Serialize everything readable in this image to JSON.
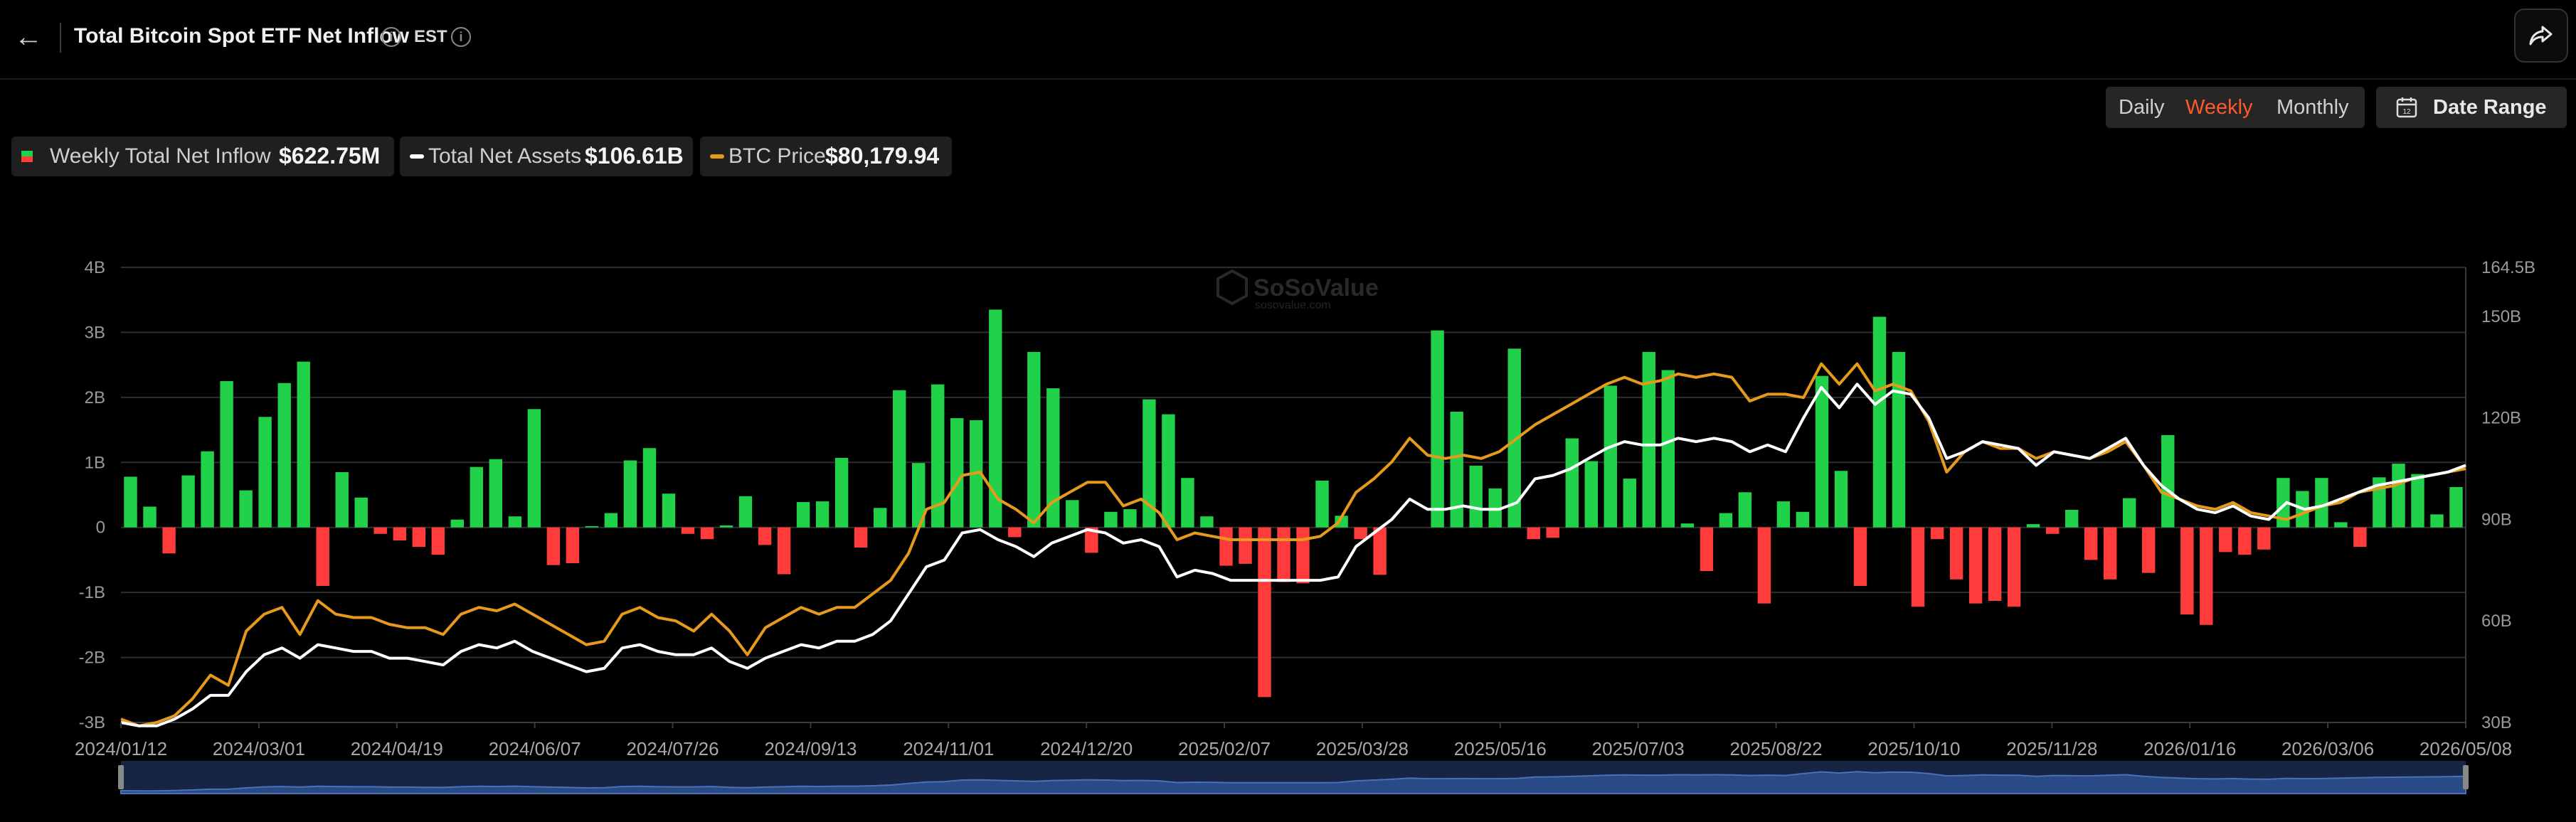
{
  "header": {
    "title": "Total Bitcoin Spot ETF Net Inflow",
    "timezone": "EST"
  },
  "controls": {
    "periods": [
      "Daily",
      "Weekly",
      "Monthly"
    ],
    "active_period": "Weekly",
    "date_range_label": "Date Range"
  },
  "legend": {
    "inflow_label": "Weekly Total Net Inflow",
    "inflow_value": "$622.75M",
    "assets_label": "Total Net Assets",
    "assets_value": "$106.61B",
    "price_label": "BTC Price",
    "price_value": "$80,179.94"
  },
  "colors": {
    "positive_bar": "#21d14a",
    "negative_bar": "#ff3b3b",
    "assets_line": "#ffffff",
    "price_line": "#e59a1c",
    "accent": "#ff5a2c"
  },
  "watermark": {
    "brand": "SoSoValue",
    "site": "sosovalue.com"
  },
  "chart_data": {
    "type": "bar",
    "title": "",
    "x_ticks": [
      "2024/01/12",
      "2024/03/01",
      "2024/04/19",
      "2024/06/07",
      "2024/07/26",
      "2024/09/13",
      "2024/11/01",
      "2024/12/20",
      "2025/02/07",
      "2025/03/28",
      "2025/05/16",
      "2025/07/03",
      "2025/08/22",
      "2025/10/10",
      "2025/11/28",
      "2026/01/16",
      "2026/03/06",
      "2026/05/08"
    ],
    "y_left_ticks": [
      "4B",
      "3B",
      "2B",
      "1B",
      "0",
      "-1B",
      "-2B",
      "-3B"
    ],
    "y_left_range": [
      -3,
      4
    ],
    "y_left_unit": "B USD",
    "y_right_ticks": [
      "164.5B",
      "150B",
      "120B",
      "90B",
      "60B",
      "30B"
    ],
    "y_right_range": [
      30,
      164.5
    ],
    "grid": true,
    "series": [
      {
        "name": "Weekly Total Net Inflow",
        "type": "bar",
        "axis": "left",
        "values": [
          0.78,
          0.32,
          -0.4,
          0.8,
          1.17,
          2.25,
          0.57,
          1.7,
          2.22,
          2.55,
          -0.9,
          0.85,
          0.46,
          -0.1,
          -0.2,
          -0.3,
          -0.42,
          0.12,
          0.93,
          1.05,
          0.17,
          1.82,
          -0.58,
          -0.55,
          0.02,
          0.22,
          1.03,
          1.22,
          0.52,
          -0.1,
          -0.18,
          0.03,
          0.48,
          -0.27,
          -0.72,
          0.39,
          0.4,
          1.07,
          -0.31,
          0.3,
          2.11,
          0.99,
          2.2,
          1.68,
          1.65,
          3.35,
          -0.15,
          2.7,
          2.14,
          0.42,
          -0.39,
          0.24,
          0.28,
          1.97,
          1.74,
          0.76,
          0.17,
          -0.59,
          -0.56,
          -2.61,
          -0.84,
          -0.86,
          0.72,
          0.18,
          -0.18,
          -0.73,
          0.0,
          0.0,
          3.03,
          1.78,
          0.95,
          0.6,
          2.75,
          -0.18,
          -0.16,
          1.37,
          1.02,
          2.18,
          0.75,
          2.7,
          2.42,
          0.06,
          -0.67,
          0.22,
          0.54,
          -1.17,
          0.4,
          0.24,
          2.33,
          0.87,
          -0.9,
          3.24,
          2.7,
          -1.22,
          -0.18,
          -0.8,
          -1.17,
          -1.13,
          -1.22,
          0.05,
          -0.1,
          0.27,
          -0.5,
          -0.8,
          0.45,
          -0.7,
          1.42,
          -1.34,
          -1.5,
          -0.38,
          -0.42,
          -0.34,
          0.76,
          0.56,
          0.76,
          0.08,
          -0.3,
          0.77,
          0.98,
          0.82,
          0.2,
          0.62
        ]
      },
      {
        "name": "Total Net Assets",
        "type": "line",
        "axis": "right",
        "values": [
          30,
          29,
          29,
          31,
          34,
          38,
          38,
          45,
          50,
          52,
          49,
          53,
          52,
          51,
          51,
          49,
          49,
          48,
          47,
          51,
          53,
          52,
          54,
          51,
          49,
          47,
          45,
          46,
          52,
          53,
          51,
          50,
          50,
          52,
          48,
          46,
          49,
          51,
          53,
          52,
          54,
          54,
          56,
          60,
          68,
          76,
          78,
          86,
          87,
          84,
          82,
          79,
          83,
          85,
          87,
          86,
          83,
          84,
          82,
          73,
          75,
          74,
          72,
          72,
          72,
          72,
          72,
          72,
          73,
          82,
          86,
          90,
          96,
          93,
          93,
          94,
          93,
          93,
          95,
          102,
          103,
          105,
          108,
          111,
          113,
          112,
          112,
          114,
          113,
          114,
          113,
          110,
          112,
          110,
          120,
          129,
          123,
          130,
          124,
          128,
          127,
          120,
          108,
          110,
          113,
          112,
          111,
          106,
          110,
          109,
          108,
          111,
          114,
          106,
          100,
          96,
          93,
          92,
          94,
          91,
          90,
          95,
          93,
          94,
          96,
          98,
          100,
          101,
          102,
          103,
          104,
          106
        ]
      },
      {
        "name": "BTC Price",
        "type": "line",
        "axis": "right",
        "values": [
          31,
          29,
          30,
          32,
          37,
          44,
          41,
          57,
          62,
          64,
          56,
          66,
          62,
          61,
          61,
          59,
          58,
          58,
          56,
          62,
          64,
          63,
          65,
          62,
          59,
          56,
          53,
          54,
          62,
          64,
          61,
          60,
          57,
          62,
          57,
          50,
          58,
          61,
          64,
          62,
          64,
          64,
          68,
          72,
          80,
          93,
          95,
          103,
          104,
          96,
          93,
          89,
          95,
          98,
          101,
          101,
          94,
          96,
          92,
          84,
          86,
          85,
          84,
          84,
          84,
          84,
          84,
          85,
          89,
          98,
          102,
          107,
          114,
          109,
          108,
          109,
          108,
          110,
          114,
          118,
          121,
          124,
          127,
          130,
          132,
          130,
          131,
          133,
          132,
          133,
          132,
          125,
          127,
          127,
          126,
          136,
          130,
          136,
          128,
          130,
          128,
          119,
          104,
          110,
          113,
          111,
          111,
          108,
          110,
          109,
          108,
          110,
          113,
          106,
          98,
          96,
          94,
          93,
          95,
          92,
          91,
          90,
          92,
          94,
          95,
          98,
          99,
          100,
          102,
          103,
          104,
          105
        ]
      }
    ]
  }
}
